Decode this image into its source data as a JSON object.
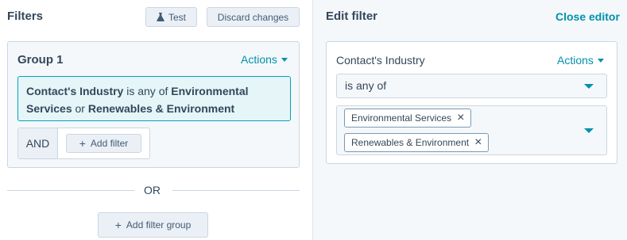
{
  "filters_panel": {
    "title": "Filters",
    "test_label": "Test",
    "test_icon": "flask-icon",
    "discard_label": "Discard changes",
    "group": {
      "title": "Group 1",
      "actions_label": "Actions",
      "condition": {
        "property": "Contact's Industry",
        "operator": "is any of",
        "value1": "Environmental",
        "value1_cont": "Services",
        "conjunction": "or",
        "value2": "Renewables & Environment"
      },
      "and_label": "AND",
      "add_filter_label": "Add filter"
    },
    "or_label": "OR",
    "add_group_label": "Add filter group"
  },
  "edit_panel": {
    "title": "Edit filter",
    "close_label": "Close editor",
    "property_label": "Contact's Industry",
    "actions_label": "Actions",
    "operator_value": "is any of",
    "selected_values": [
      "Environmental Services",
      "Renewables & Environment"
    ]
  },
  "colors": {
    "accent": "#0091ae",
    "condition_bg": "#e5f5f8",
    "condition_border": "#00a4bd",
    "panel_bg": "#f5f8fa",
    "text": "#33475b"
  }
}
